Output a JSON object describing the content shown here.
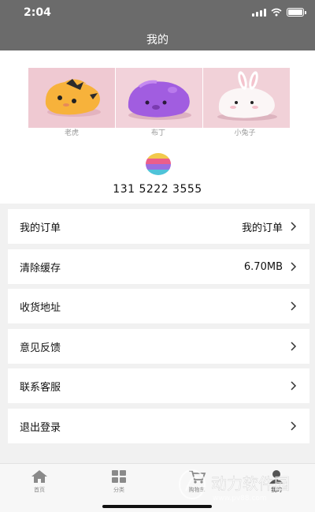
{
  "status_bar": {
    "time": "2:04"
  },
  "header": {
    "title": "我的"
  },
  "profile": {
    "gallery": [
      {
        "caption": "老虎"
      },
      {
        "caption": "布丁"
      },
      {
        "caption": "小兔子"
      }
    ],
    "phone": "131 5222 3555"
  },
  "menu": {
    "items": [
      {
        "label": "我的订单",
        "value": "我的订单"
      },
      {
        "label": "清除缓存",
        "value": "6.70MB"
      },
      {
        "label": "收货地址",
        "value": ""
      },
      {
        "label": "意见反馈",
        "value": ""
      },
      {
        "label": "联系客服",
        "value": ""
      },
      {
        "label": "退出登录",
        "value": ""
      }
    ]
  },
  "tabbar": {
    "tabs": [
      {
        "label": "首页",
        "icon": "home-icon"
      },
      {
        "label": "分类",
        "icon": "grid-icon"
      },
      {
        "label": "购物车",
        "icon": "cart-icon"
      },
      {
        "label": "我的",
        "icon": "user-icon"
      }
    ]
  },
  "watermark": {
    "text": "动力软件园",
    "url": "www.pv88.com"
  },
  "colors": {
    "header_bg": "#6b6b6b",
    "page_bg": "#f1f1f1",
    "card_bg": "#ffffff"
  }
}
